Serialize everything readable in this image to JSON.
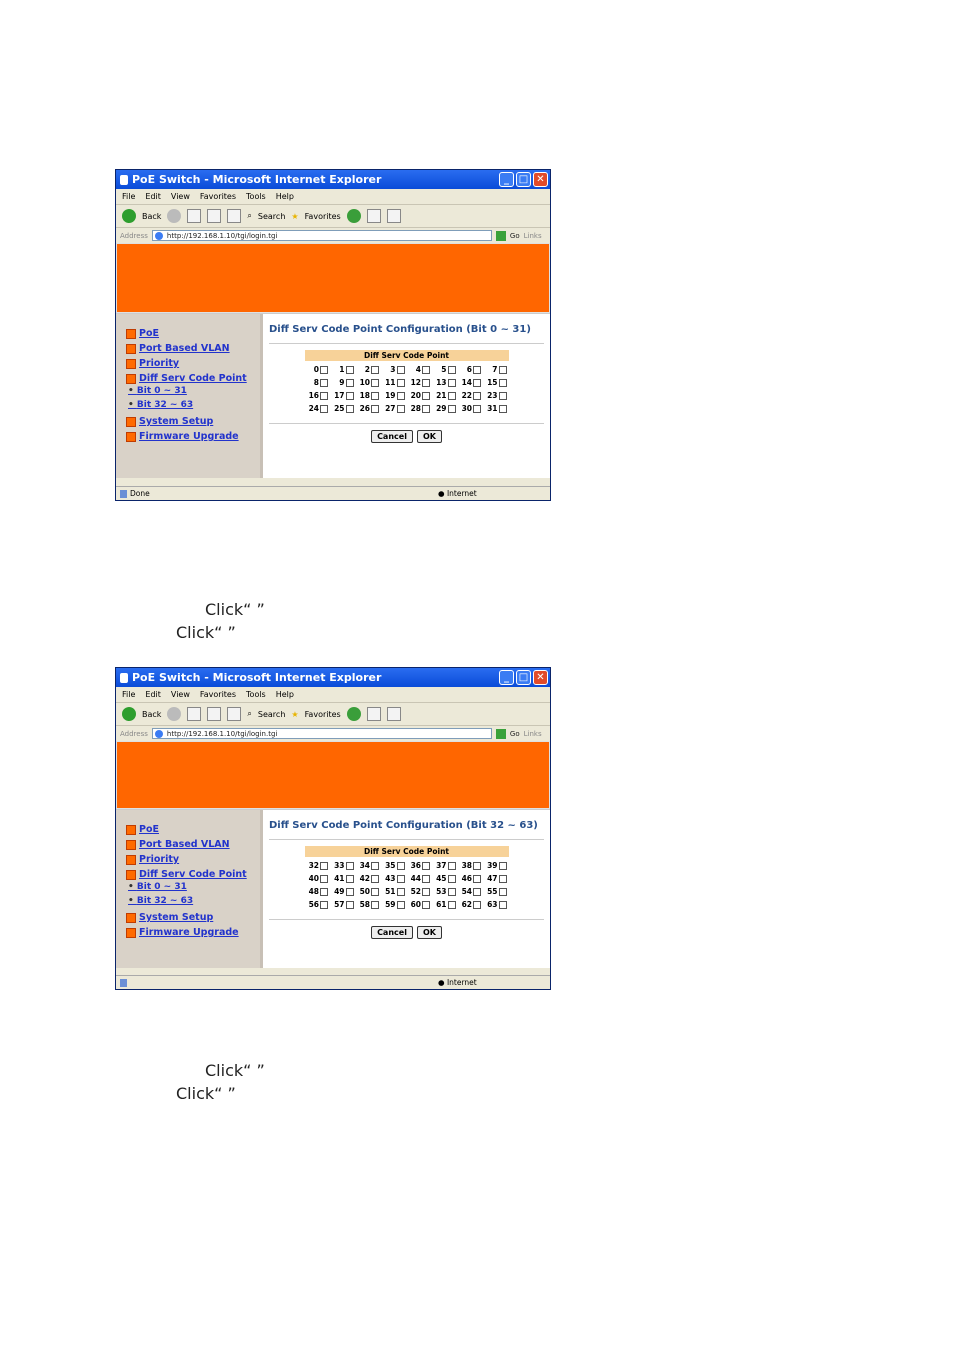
{
  "window": {
    "title": "PoE Switch - Microsoft Internet Explorer",
    "menu": [
      "File",
      "Edit",
      "View",
      "Favorites",
      "Tools",
      "Help"
    ],
    "toolbar": {
      "back": "Back",
      "search": "Search",
      "favorites": "Favorites"
    },
    "address_label": "Address",
    "url": "http://192.168.1.10/tgi/login.tgi",
    "go": "Go",
    "links": "Links"
  },
  "sidebar": {
    "items": [
      "PoE",
      "Port Based VLAN",
      "Priority",
      "Diff Serv Code Point"
    ],
    "subitems": [
      "Bit 0 ~ 31",
      "Bit 32 ~ 63"
    ],
    "items_after": [
      "System Setup",
      "Firmware Upgrade"
    ]
  },
  "screens": [
    {
      "title": "Diff Serv Code Point Configuration (Bit 0 ~ 31)",
      "table_header": "Diff Serv Code Point",
      "rows": [
        [
          "0",
          "1",
          "2",
          "3",
          "4",
          "5",
          "6",
          "7"
        ],
        [
          "8",
          "9",
          "10",
          "11",
          "12",
          "13",
          "14",
          "15"
        ],
        [
          "16",
          "17",
          "18",
          "19",
          "20",
          "21",
          "22",
          "23"
        ],
        [
          "24",
          "25",
          "26",
          "27",
          "28",
          "29",
          "30",
          "31"
        ]
      ],
      "cancel": "Cancel",
      "ok": "OK",
      "status": "Done",
      "zone": "Internet"
    },
    {
      "title": "Diff Serv Code Point Configuration (Bit 32 ~ 63)",
      "table_header": "Diff Serv Code Point",
      "rows": [
        [
          "32",
          "33",
          "34",
          "35",
          "36",
          "37",
          "38",
          "39"
        ],
        [
          "40",
          "41",
          "42",
          "43",
          "44",
          "45",
          "46",
          "47"
        ],
        [
          "48",
          "49",
          "50",
          "51",
          "52",
          "53",
          "54",
          "55"
        ],
        [
          "56",
          "57",
          "58",
          "59",
          "60",
          "61",
          "62",
          "63"
        ]
      ],
      "cancel": "Cancel",
      "ok": "OK",
      "status": "",
      "zone": "Internet"
    }
  ],
  "captions": [
    {
      "line1": "Click“        ”",
      "line2": "Click“   ”"
    },
    {
      "line1": "Click“        ”",
      "line2": "Click“   ”"
    }
  ]
}
